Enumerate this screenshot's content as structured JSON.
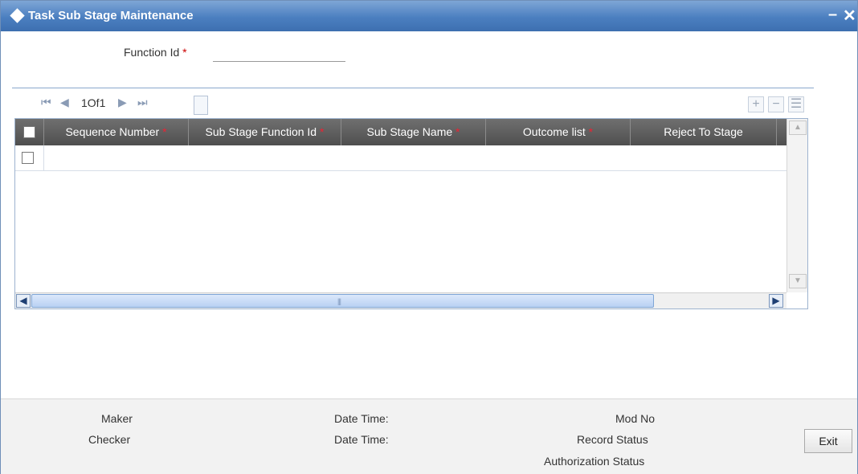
{
  "window": {
    "title": "Task Sub Stage Maintenance",
    "minimize_glyph": "–",
    "close_glyph": "✕"
  },
  "form": {
    "function_id_label": "Function Id",
    "required_mark": "*",
    "function_id_value": ""
  },
  "pager": {
    "first_glyph": "⏮",
    "prev_glyph": "◀",
    "text": "1Of1",
    "next_glyph": "▶",
    "last_glyph": "⏭"
  },
  "toolbar": {
    "add_glyph": "+",
    "delete_glyph": "−",
    "view_glyph": "☰"
  },
  "grid": {
    "columns": [
      {
        "label": "Sequence Number",
        "required": "*"
      },
      {
        "label": "Sub Stage Function Id",
        "required": "*"
      },
      {
        "label": "Sub Stage Name",
        "required": "*"
      },
      {
        "label": "Outcome list",
        "required": "*"
      },
      {
        "label": "Reject To Stage",
        "required": ""
      }
    ],
    "scroll_left": "◀",
    "scroll_right": "▶",
    "scroll_up": "▲",
    "scroll_down": "▼",
    "thumb_grip": "|||"
  },
  "footer": {
    "maker": "Maker",
    "checker": "Checker",
    "date_time_1": "Date Time:",
    "date_time_2": "Date Time:",
    "mod_no": "Mod No",
    "record_status": "Record Status",
    "authorization_status": "Authorization Status",
    "exit_label": "Exit"
  },
  "colors": {
    "titlebar": "#4b7fc0",
    "grid_header": "#5a5a5a",
    "required": "#cc0000"
  }
}
